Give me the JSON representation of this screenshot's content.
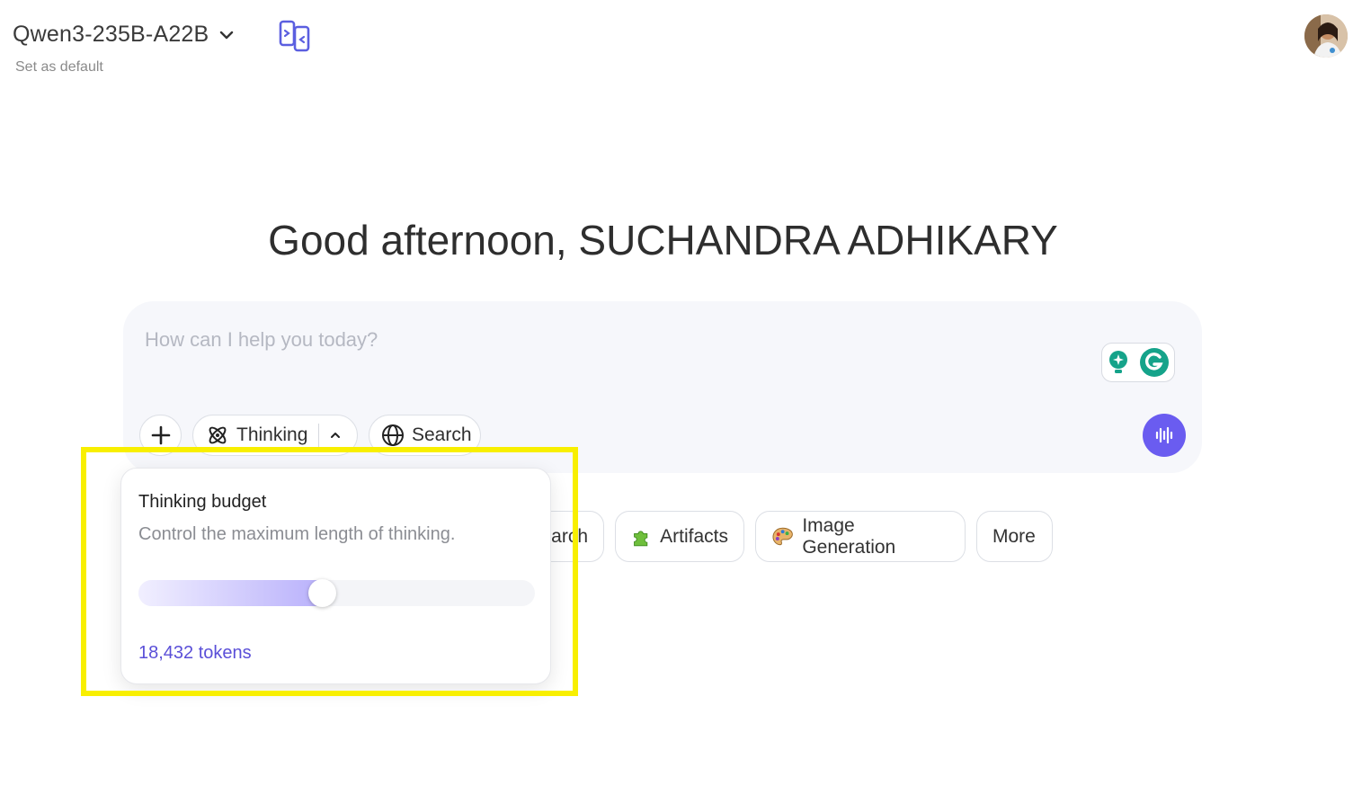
{
  "header": {
    "model_name": "Qwen3-235B-A22B",
    "set_default": "Set as default",
    "icons": [
      "chevron-down-icon",
      "compare-icon",
      "avatar"
    ]
  },
  "greeting": "Good afternoon, SUCHANDRA ADHIKARY",
  "composer": {
    "placeholder": "How can I help you today?",
    "thinking_label": "Thinking",
    "search_label": "Search",
    "icons": [
      "plus-icon",
      "thinking-icon",
      "chevron-up-icon",
      "globe-icon",
      "grammarly-icon",
      "voice-icon"
    ]
  },
  "chips": {
    "partial_label": "arch",
    "artifacts_label": "Artifacts",
    "image_generation_label": "Image Generation",
    "more_label": "More"
  },
  "thinking_budget": {
    "title": "Thinking budget",
    "description": "Control the maximum length of thinking.",
    "tokens_label": "18,432 tokens",
    "slider_level_fraction": 0.465
  },
  "colors": {
    "accent": "#6a5cf0",
    "tokens_text": "#5a4fd8",
    "highlight_box": "#f8ef00",
    "composer_bg": "#f6f7fb"
  }
}
